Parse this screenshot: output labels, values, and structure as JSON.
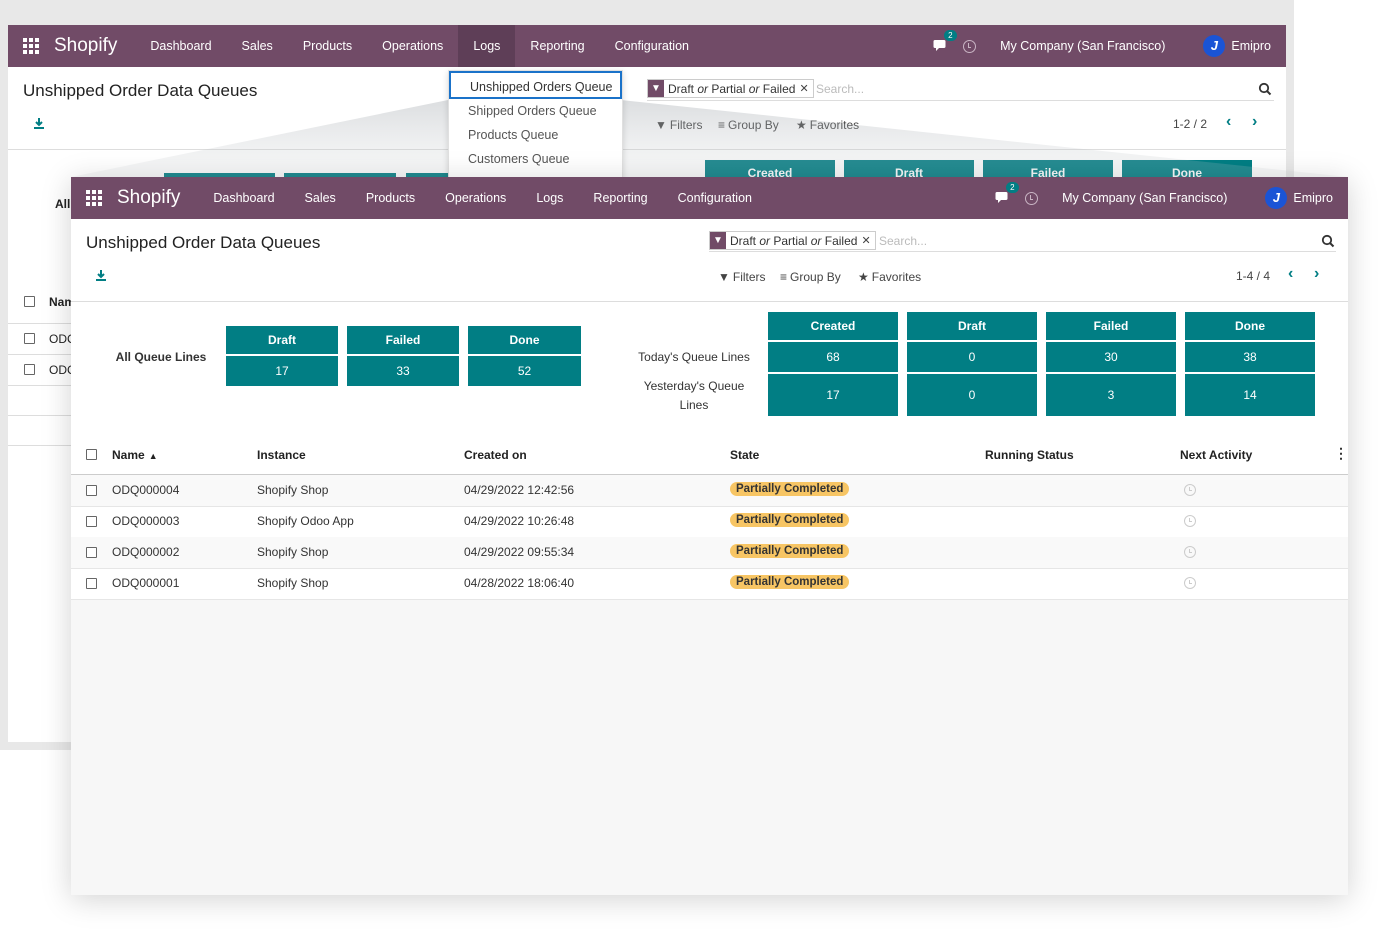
{
  "navbar": {
    "brand": "Shopify",
    "menus": [
      "Dashboard",
      "Sales",
      "Products",
      "Operations",
      "Logs",
      "Reporting",
      "Configuration"
    ],
    "chat_count": "2",
    "company": "My Company (San Francisco)",
    "user": "Emipro",
    "avatar_letter": "J"
  },
  "back": {
    "title": "Unshipped Order Data Queues",
    "pager": "1-2 / 2",
    "dropdown": [
      "Unshipped Orders Queue",
      "Shipped Orders Queue",
      "Products Queue",
      "Customers Queue"
    ],
    "peek_tiles": [
      "Created",
      "Draft",
      "Failed",
      "Done"
    ],
    "peek_left": [
      "All",
      "Nam",
      "ODC",
      "ODC"
    ]
  },
  "search": {
    "facet_parts": [
      "Draft",
      "or",
      "Partial",
      "or",
      "Failed"
    ],
    "placeholder": "Search..."
  },
  "toolbar": {
    "filters": "Filters",
    "group_by": "Group By",
    "favorites": "Favorites"
  },
  "front": {
    "title": "Unshipped Order Data Queues",
    "pager": "1-4 / 4"
  },
  "dashboard": {
    "all_label": "All Queue Lines",
    "all": {
      "headers": [
        "Draft",
        "Failed",
        "Done"
      ],
      "values": [
        "17",
        "33",
        "52"
      ]
    },
    "today_label": "Today's Queue Lines",
    "yesterday_label": "Yesterday's Queue Lines",
    "period_headers": [
      "Created",
      "Draft",
      "Failed",
      "Done"
    ],
    "today_values": [
      "68",
      "0",
      "30",
      "38"
    ],
    "yesterday_values": [
      "17",
      "0",
      "3",
      "14"
    ]
  },
  "table": {
    "columns": [
      "Name",
      "Instance",
      "Created on",
      "State",
      "Running Status",
      "Next Activity"
    ],
    "rows": [
      {
        "name": "ODQ000004",
        "instance": "Shopify Shop",
        "created_on": "04/29/2022 12:42:56",
        "state": "Partially Completed"
      },
      {
        "name": "ODQ000003",
        "instance": "Shopify Odoo App",
        "created_on": "04/29/2022 10:26:48",
        "state": "Partially Completed"
      },
      {
        "name": "ODQ000002",
        "instance": "Shopify Shop",
        "created_on": "04/29/2022 09:55:34",
        "state": "Partially Completed"
      },
      {
        "name": "ODQ000001",
        "instance": "Shopify Shop",
        "created_on": "04/28/2022 18:06:40",
        "state": "Partially Completed"
      }
    ]
  },
  "colors": {
    "navbar": "#714b67",
    "tile": "#017e84",
    "badge": "#f7c564",
    "accent_link": "#017e84"
  }
}
